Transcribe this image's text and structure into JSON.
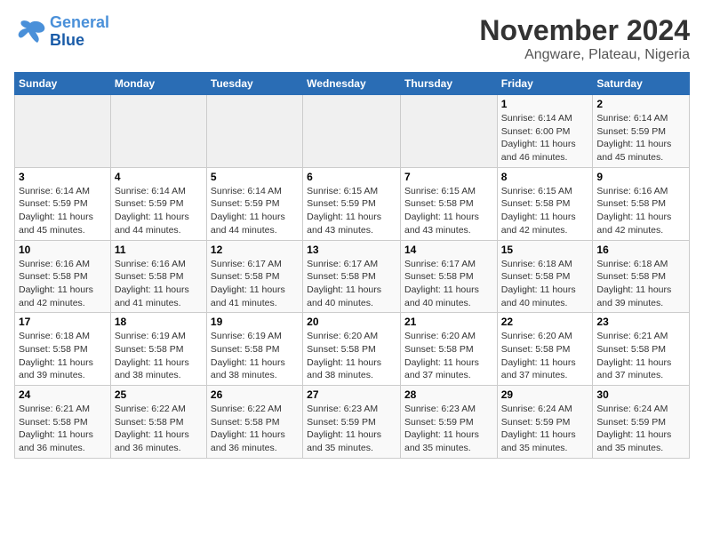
{
  "header": {
    "logo": {
      "line1": "General",
      "line2": "Blue"
    },
    "title": "November 2024",
    "subtitle": "Angware, Plateau, Nigeria"
  },
  "weekdays": [
    "Sunday",
    "Monday",
    "Tuesday",
    "Wednesday",
    "Thursday",
    "Friday",
    "Saturday"
  ],
  "weeks": [
    [
      {
        "day": "",
        "info": ""
      },
      {
        "day": "",
        "info": ""
      },
      {
        "day": "",
        "info": ""
      },
      {
        "day": "",
        "info": ""
      },
      {
        "day": "",
        "info": ""
      },
      {
        "day": "1",
        "info": "Sunrise: 6:14 AM\nSunset: 6:00 PM\nDaylight: 11 hours\nand 46 minutes."
      },
      {
        "day": "2",
        "info": "Sunrise: 6:14 AM\nSunset: 5:59 PM\nDaylight: 11 hours\nand 45 minutes."
      }
    ],
    [
      {
        "day": "3",
        "info": "Sunrise: 6:14 AM\nSunset: 5:59 PM\nDaylight: 11 hours\nand 45 minutes."
      },
      {
        "day": "4",
        "info": "Sunrise: 6:14 AM\nSunset: 5:59 PM\nDaylight: 11 hours\nand 44 minutes."
      },
      {
        "day": "5",
        "info": "Sunrise: 6:14 AM\nSunset: 5:59 PM\nDaylight: 11 hours\nand 44 minutes."
      },
      {
        "day": "6",
        "info": "Sunrise: 6:15 AM\nSunset: 5:59 PM\nDaylight: 11 hours\nand 43 minutes."
      },
      {
        "day": "7",
        "info": "Sunrise: 6:15 AM\nSunset: 5:58 PM\nDaylight: 11 hours\nand 43 minutes."
      },
      {
        "day": "8",
        "info": "Sunrise: 6:15 AM\nSunset: 5:58 PM\nDaylight: 11 hours\nand 42 minutes."
      },
      {
        "day": "9",
        "info": "Sunrise: 6:16 AM\nSunset: 5:58 PM\nDaylight: 11 hours\nand 42 minutes."
      }
    ],
    [
      {
        "day": "10",
        "info": "Sunrise: 6:16 AM\nSunset: 5:58 PM\nDaylight: 11 hours\nand 42 minutes."
      },
      {
        "day": "11",
        "info": "Sunrise: 6:16 AM\nSunset: 5:58 PM\nDaylight: 11 hours\nand 41 minutes."
      },
      {
        "day": "12",
        "info": "Sunrise: 6:17 AM\nSunset: 5:58 PM\nDaylight: 11 hours\nand 41 minutes."
      },
      {
        "day": "13",
        "info": "Sunrise: 6:17 AM\nSunset: 5:58 PM\nDaylight: 11 hours\nand 40 minutes."
      },
      {
        "day": "14",
        "info": "Sunrise: 6:17 AM\nSunset: 5:58 PM\nDaylight: 11 hours\nand 40 minutes."
      },
      {
        "day": "15",
        "info": "Sunrise: 6:18 AM\nSunset: 5:58 PM\nDaylight: 11 hours\nand 40 minutes."
      },
      {
        "day": "16",
        "info": "Sunrise: 6:18 AM\nSunset: 5:58 PM\nDaylight: 11 hours\nand 39 minutes."
      }
    ],
    [
      {
        "day": "17",
        "info": "Sunrise: 6:18 AM\nSunset: 5:58 PM\nDaylight: 11 hours\nand 39 minutes."
      },
      {
        "day": "18",
        "info": "Sunrise: 6:19 AM\nSunset: 5:58 PM\nDaylight: 11 hours\nand 38 minutes."
      },
      {
        "day": "19",
        "info": "Sunrise: 6:19 AM\nSunset: 5:58 PM\nDaylight: 11 hours\nand 38 minutes."
      },
      {
        "day": "20",
        "info": "Sunrise: 6:20 AM\nSunset: 5:58 PM\nDaylight: 11 hours\nand 38 minutes."
      },
      {
        "day": "21",
        "info": "Sunrise: 6:20 AM\nSunset: 5:58 PM\nDaylight: 11 hours\nand 37 minutes."
      },
      {
        "day": "22",
        "info": "Sunrise: 6:20 AM\nSunset: 5:58 PM\nDaylight: 11 hours\nand 37 minutes."
      },
      {
        "day": "23",
        "info": "Sunrise: 6:21 AM\nSunset: 5:58 PM\nDaylight: 11 hours\nand 37 minutes."
      }
    ],
    [
      {
        "day": "24",
        "info": "Sunrise: 6:21 AM\nSunset: 5:58 PM\nDaylight: 11 hours\nand 36 minutes."
      },
      {
        "day": "25",
        "info": "Sunrise: 6:22 AM\nSunset: 5:58 PM\nDaylight: 11 hours\nand 36 minutes."
      },
      {
        "day": "26",
        "info": "Sunrise: 6:22 AM\nSunset: 5:58 PM\nDaylight: 11 hours\nand 36 minutes."
      },
      {
        "day": "27",
        "info": "Sunrise: 6:23 AM\nSunset: 5:59 PM\nDaylight: 11 hours\nand 35 minutes."
      },
      {
        "day": "28",
        "info": "Sunrise: 6:23 AM\nSunset: 5:59 PM\nDaylight: 11 hours\nand 35 minutes."
      },
      {
        "day": "29",
        "info": "Sunrise: 6:24 AM\nSunset: 5:59 PM\nDaylight: 11 hours\nand 35 minutes."
      },
      {
        "day": "30",
        "info": "Sunrise: 6:24 AM\nSunset: 5:59 PM\nDaylight: 11 hours\nand 35 minutes."
      }
    ]
  ]
}
